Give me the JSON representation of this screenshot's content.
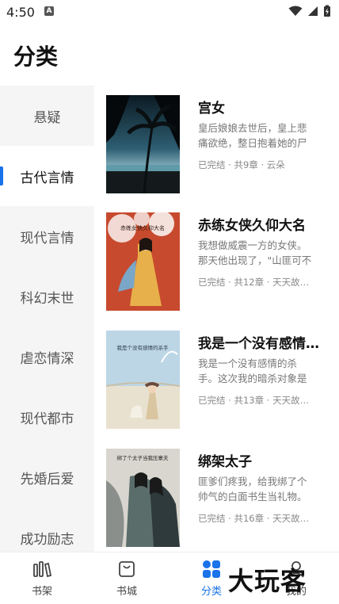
{
  "status": {
    "time": "4:50",
    "notification_badge": "A"
  },
  "page_title": "分类",
  "categories": [
    {
      "label": "悬疑"
    },
    {
      "label": "古代言情"
    },
    {
      "label": "现代言情"
    },
    {
      "label": "科幻末世"
    },
    {
      "label": "虐恋情深"
    },
    {
      "label": "现代都市"
    },
    {
      "label": "先婚后爱"
    },
    {
      "label": "成功励志"
    }
  ],
  "active_category": "古代言情",
  "books": [
    {
      "title": "宫女",
      "desc": "皇后娘娘去世后，皇上悲痛欲绝，整日抱着她的尸体…",
      "meta": "已完结 · 共9章 · 云朵"
    },
    {
      "title": "赤练女侠久仰大名",
      "desc": "我想做威震一方的女侠。那天他出现了，\"山匪可不是…",
      "meta": "已完结 · 共12章 · 天天故事…"
    },
    {
      "title": "我是一个没有感情…",
      "desc": "我是一个没有感情的杀手。这次我的暗杀对象是一个…",
      "meta": "已完结 · 共13章 · 天天故事…"
    },
    {
      "title": "绑架太子",
      "desc": "匪爹们疼我，给我绑了个帅气的白面书生当礼物。唔…",
      "meta": "已完结 · 共16章 · 天天故事…"
    }
  ],
  "covers": [
    {
      "text": ""
    },
    {
      "text": "赤练女侠久仰大名"
    },
    {
      "text": "我是个没有感情的杀手"
    },
    {
      "text": "绑了个太子当我压寨夫"
    }
  ],
  "tabs": [
    {
      "label": "书架",
      "icon": "bookshelf-icon"
    },
    {
      "label": "书城",
      "icon": "bookstore-bag-icon"
    },
    {
      "label": "分类",
      "icon": "category-grid-icon"
    },
    {
      "label": "我的",
      "icon": "profile-icon"
    }
  ],
  "active_tab": "分类",
  "watermark": "大玩客",
  "colors": {
    "accent": "#1a73e8",
    "sidebar_bg": "#f5f5f5"
  }
}
